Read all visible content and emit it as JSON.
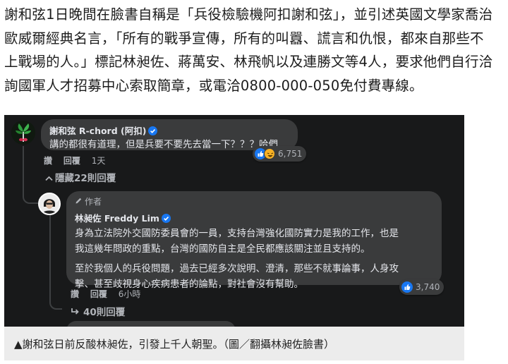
{
  "article": {
    "lines": [
      "謝和弦1日晚間在臉書自稱是「兵役檢驗機阿扣謝和弦」，並引述英國文學家喬治",
      "歐威爾經典名言，「所有的戰爭宣傳，所有的叫囂、謊言和仇恨，都來自那些不",
      "上戰場的人。」標記林昶佐、蔣萬安、林飛帆以及連勝文等4人，要求他們自行洽",
      "詢國軍人才招募中心索取簡章，或電洽0800-000-050免付費專線。"
    ]
  },
  "comment_main": {
    "name": "謝和弦 R-chord (阿扣)",
    "text": "講的都很有道理，但是兵要不要先去當一下？？？哈們",
    "reaction_count": "6,751",
    "actions": {
      "like": "讚",
      "reply": "回覆",
      "time": "1天"
    },
    "hide_replies": "隱藏22則回覆"
  },
  "comment_reply": {
    "author_tag": "作者",
    "name": "林昶佐 Freddy Lim",
    "paragraph1": [
      "身為立法院外交國防委員會的一員，支持台灣強化國防實力是我的工作，也是",
      "我這幾年問政的重點，台灣的國防自主是全民都應該關注並且支持的。"
    ],
    "paragraph2": [
      "至於我個人的兵役問題，過去已經多次說明、澄清，那些不就事論事，人身攻",
      "擊、甚至歧視身心疾病患者的論點，對社會沒有幫助。"
    ],
    "reaction_count": "3,740",
    "actions": {
      "like": "讚",
      "reply": "回覆",
      "time": "6小時"
    },
    "more_replies": "40則回覆"
  },
  "caption": "▲謝和弦日前反酸林昶佐，引發上千人朝聖。（圖／翻攝林昶佐臉書）",
  "colors": {
    "dark_bg": "#18191a",
    "bubble": "#3a3b3c",
    "text": "#e4e6eb",
    "muted": "#b0b3b8",
    "like_blue": "#1877f2"
  },
  "icons": [
    "verified-badge-icon",
    "like-reaction-icon",
    "haha-reaction-icon",
    "chevron-up-icon",
    "reply-arrow-icon",
    "pencil-icon"
  ]
}
